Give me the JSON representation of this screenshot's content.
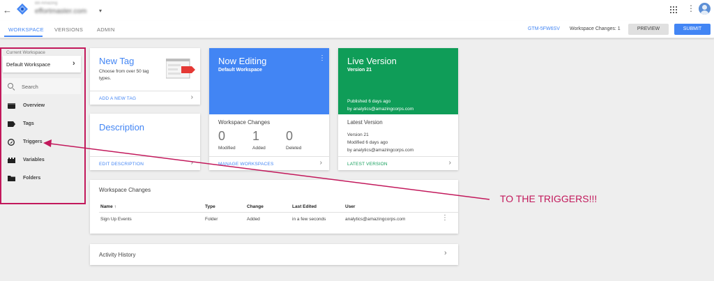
{
  "header": {
    "account_name": "Bit-Amazing",
    "container_name": "effortmaster.com",
    "icons": [
      "back-arrow-icon",
      "gtm-logo-icon",
      "caret-down-icon",
      "apps-grid-icon",
      "more-vert-icon",
      "account-avatar-icon"
    ]
  },
  "tabs": [
    {
      "label": "WORKSPACE",
      "active": true
    },
    {
      "label": "VERSIONS",
      "active": false
    },
    {
      "label": "ADMIN",
      "active": false
    }
  ],
  "toolbar": {
    "container_id": "GTM-5FW6SV",
    "workspace_changes": "Workspace Changes: 1",
    "preview_label": "PREVIEW",
    "submit_label": "SUBMIT"
  },
  "sidebar": {
    "current_workspace_label": "Current Workspace",
    "workspace_name": "Default Workspace",
    "search_placeholder": "Search",
    "items": [
      {
        "label": "Overview",
        "icon": "overview-icon"
      },
      {
        "label": "Tags",
        "icon": "tag-icon"
      },
      {
        "label": "Triggers",
        "icon": "trigger-icon"
      },
      {
        "label": "Variables",
        "icon": "variables-icon"
      },
      {
        "label": "Folders",
        "icon": "folder-icon"
      }
    ]
  },
  "new_tag_card": {
    "title": "New Tag",
    "description": "Choose from over 50 tag types.",
    "link": "ADD A NEW TAG"
  },
  "description_card": {
    "title": "Description",
    "link": "EDIT DESCRIPTION"
  },
  "now_editing_card": {
    "title": "Now Editing",
    "subtitle": "Default Workspace",
    "changes_title": "Workspace Changes",
    "stats": [
      {
        "value": "0",
        "label": "Modified"
      },
      {
        "value": "1",
        "label": "Added"
      },
      {
        "value": "0",
        "label": "Deleted"
      }
    ],
    "link": "MANAGE WORKSPACES"
  },
  "live_version_card": {
    "title": "Live Version",
    "subtitle": "Version 21",
    "published": "Published 6 days ago",
    "published_by": "by analytics@amazingcorps.com",
    "latest_title": "Latest Version",
    "latest_version": "Version 21",
    "latest_modified": "Modified 6 days ago",
    "latest_by": "by analytics@amazingcorps.com",
    "link": "LATEST VERSION"
  },
  "workspace_changes_table": {
    "title": "Workspace Changes",
    "columns": [
      "Name ↑",
      "Type",
      "Change",
      "Last Edited",
      "User"
    ],
    "rows": [
      [
        "Sign Up Events",
        "Folder",
        "Added",
        "in a few seconds",
        "analytics@amazingcorps.com"
      ]
    ]
  },
  "activity_history": {
    "title": "Activity History"
  },
  "annotation": {
    "text": "TO THE TRIGGERS!!!",
    "color": "#c2185b"
  },
  "colors": {
    "primary_blue": "#4285f4",
    "live_green": "#0f9d58",
    "annotation_magenta": "#c2185b"
  }
}
